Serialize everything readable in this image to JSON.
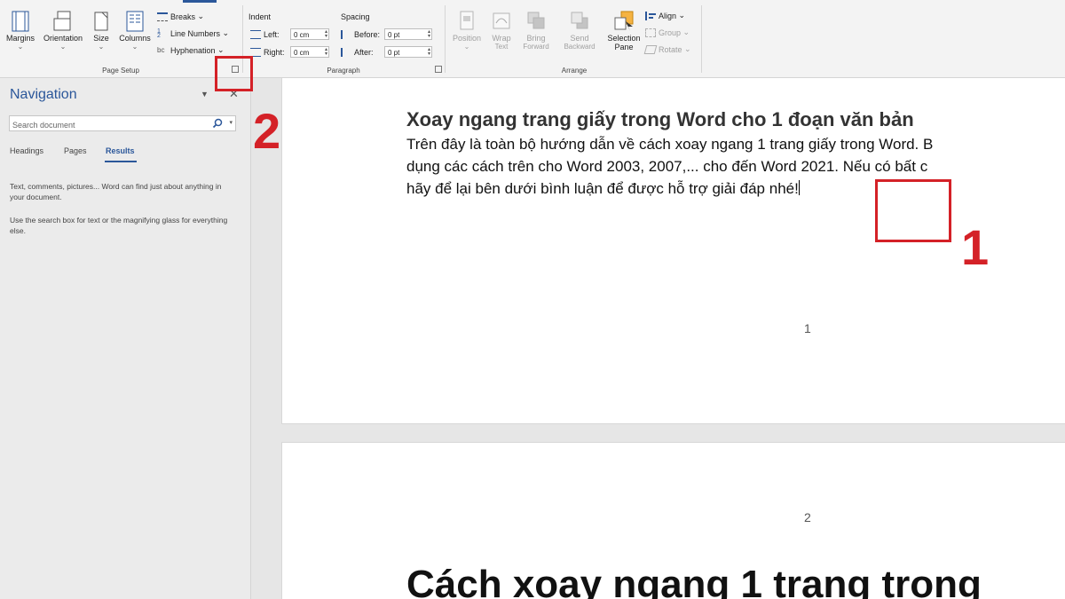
{
  "ribbon": {
    "page_setup": {
      "margins": "Margins",
      "orientation": "Orientation",
      "size": "Size",
      "columns": "Columns",
      "breaks": "Breaks",
      "line_numbers": "Line Numbers",
      "hyphenation": "Hyphenation",
      "group_label": "Page Setup"
    },
    "paragraph": {
      "indent_title": "Indent",
      "spacing_title": "Spacing",
      "left_label": "Left:",
      "right_label": "Right:",
      "before_label": "Before:",
      "after_label": "After:",
      "left_value": "0 cm",
      "right_value": "0 cm",
      "before_value": "0 pt",
      "after_value": "0 pt",
      "group_label": "Paragraph"
    },
    "arrange": {
      "position": "Position",
      "wrap_text_1": "Wrap",
      "wrap_text_2": "Text",
      "bring_forward_1": "Bring",
      "bring_forward_2": "Forward",
      "send_backward_1": "Send",
      "send_backward_2": "Backward",
      "selection_pane_1": "Selection",
      "selection_pane_2": "Pane",
      "align": "Align",
      "group": "Group",
      "rotate": "Rotate",
      "group_label": "Arrange"
    }
  },
  "navigation": {
    "title": "Navigation",
    "search_placeholder": "Search document",
    "tabs": [
      "Headings",
      "Pages",
      "Results"
    ],
    "help_1": "Text, comments, pictures... Word can find just about anything in your document.",
    "help_2": "Use the search box for text or the magnifying glass for everything else."
  },
  "document": {
    "heading": "Xoay ngang trang giấy trong Word cho 1 đoạn văn bản",
    "para_line_1": "Trên đây là toàn bộ hướng dẫn về cách xoay ngang 1 trang giấy trong Word. B",
    "para_line_2": "dụng các cách trên cho Word 2003, 2007,... cho đến Word 2021. Nếu có bất c",
    "para_line_3": "hãy để lại bên dưới bình luận để được hỗ trợ giải đáp nhé!",
    "page_number_1": "1",
    "page_number_2": "2",
    "next_heading": "Cách xoay ngang 1 trang trong"
  },
  "annotations": {
    "label_1": "1",
    "label_2": "2",
    "color": "#d42127"
  },
  "colors": {
    "accent": "#2b579a"
  }
}
